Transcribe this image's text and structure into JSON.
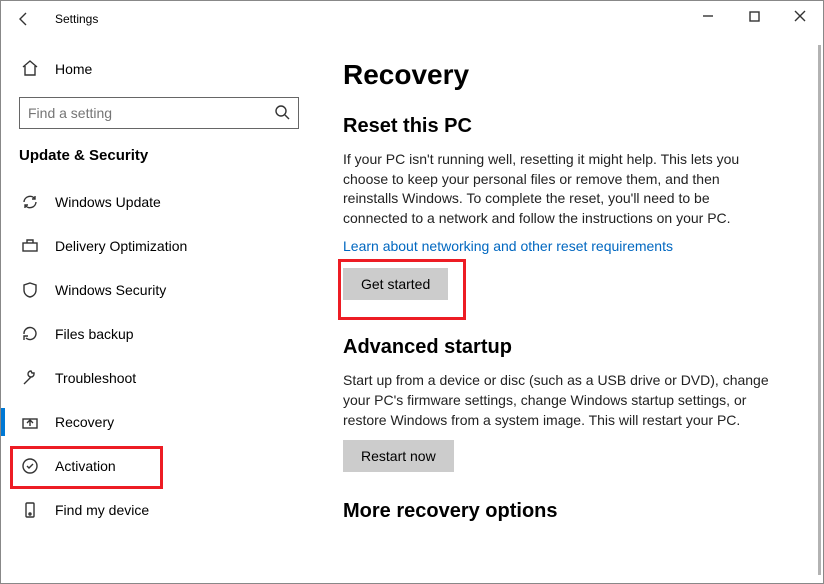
{
  "window": {
    "title": "Settings"
  },
  "sidebar": {
    "home": "Home",
    "search_placeholder": "Find a setting",
    "category": "Update & Security",
    "items": [
      {
        "label": "Windows Update",
        "icon": "sync"
      },
      {
        "label": "Delivery Optimization",
        "icon": "delivery"
      },
      {
        "label": "Windows Security",
        "icon": "shield"
      },
      {
        "label": "Files backup",
        "icon": "backup"
      },
      {
        "label": "Troubleshoot",
        "icon": "wrench"
      },
      {
        "label": "Recovery",
        "icon": "recovery",
        "selected": true
      },
      {
        "label": "Activation",
        "icon": "activation"
      },
      {
        "label": "Find my device",
        "icon": "location"
      }
    ]
  },
  "main": {
    "title": "Recovery",
    "reset": {
      "heading": "Reset this PC",
      "body": "If your PC isn't running well, resetting it might help. This lets you choose to keep your personal files or remove them, and then reinstalls Windows. To complete the reset, you'll need to be connected to a network and follow the instructions on your PC.",
      "link": "Learn about networking and other reset requirements",
      "button": "Get started"
    },
    "advanced": {
      "heading": "Advanced startup",
      "body": "Start up from a device or disc (such as a USB drive or DVD), change your PC's firmware settings, change Windows startup settings, or restore Windows from a system image. This will restart your PC.",
      "button": "Restart now"
    },
    "more": {
      "heading": "More recovery options"
    }
  }
}
